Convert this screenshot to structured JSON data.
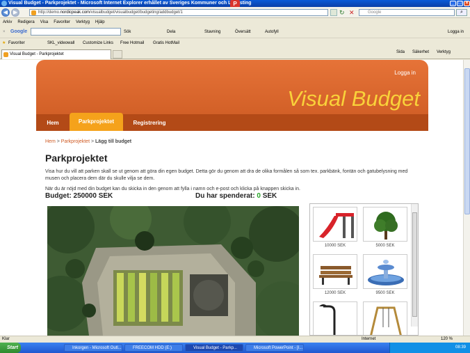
{
  "window": {
    "title": "Visual Budget - Parkprojektet - Microsoft Internet Explorer erhållet av Sveriges Kommuner och Landsting"
  },
  "address": {
    "url_prefix": "http://demo.",
    "url_domain": "nordicpeak.com",
    "url_path": "/visualbudget/visualbudget/budgeting/addbudget/1",
    "search_placeholder": "Google"
  },
  "menu": [
    "Arkiv",
    "Redigera",
    "Visa",
    "Favoriter",
    "Verktyg",
    "Hjälp"
  ],
  "googlebar": {
    "logo": "Google",
    "items": [
      "Sök",
      "Dela",
      "Stavning",
      "Översätt",
      "Autofyll"
    ],
    "login": "Logga in"
  },
  "favorites": {
    "label": "Favoriter",
    "links": [
      "SKL_videowall",
      "Customize Links",
      "Free Hotmail",
      "Gratis HotMail"
    ]
  },
  "tab": {
    "title": "Visual Budget - Parkprojektet"
  },
  "commandbar": [
    "Sida",
    "Säkerhet",
    "Verktyg"
  ],
  "site": {
    "login": "Logga in",
    "brand": "Visual Budget",
    "nav": [
      "Hem",
      "Parkprojektet",
      "Registrering"
    ],
    "breadcrumb": {
      "home": "Hem",
      "project": "Parkprojektet",
      "current": "Lägg till budget"
    },
    "title": "Parkprojektet",
    "para1": "Visa hur du vill att parken skall se ut genom att göra din egen budget. Detta gör du genom att dra de olika formålen så som tex. parkbänk, fontän och gatubelysning med musen och placera dem där du skulle vilja se dem.",
    "para2": "När du är nöjd med din budget kan du skicka in den genom att fylla i namn och e-post och klicka på knappen skicka in.",
    "budget_label": "Budget: 250000 SEK",
    "spent_label": "Du har spenderat:",
    "spent_value": "0",
    "spent_unit": "SEK",
    "items": [
      {
        "price": "10000 SEK",
        "icon": "slide-icon"
      },
      {
        "price": "5000 SEK",
        "icon": "tree-icon"
      },
      {
        "price": "12000 SEK",
        "icon": "bench-icon"
      },
      {
        "price": "9500 SEK",
        "icon": "fountain-icon"
      },
      {
        "price": "",
        "icon": "streetlamp-icon"
      },
      {
        "price": "",
        "icon": "swing-icon"
      }
    ]
  },
  "status": {
    "left": "Klar",
    "zone": "Internet",
    "zoom": "120 %"
  },
  "taskbar": {
    "start": "Start",
    "buttons": [
      "Inkorgen - Microsoft Outl...",
      "FREECOM HDD (E:)",
      "Visual Budget - Parkp...",
      "Microsoft PowerPoint - [I..."
    ],
    "clock": "08:39"
  }
}
